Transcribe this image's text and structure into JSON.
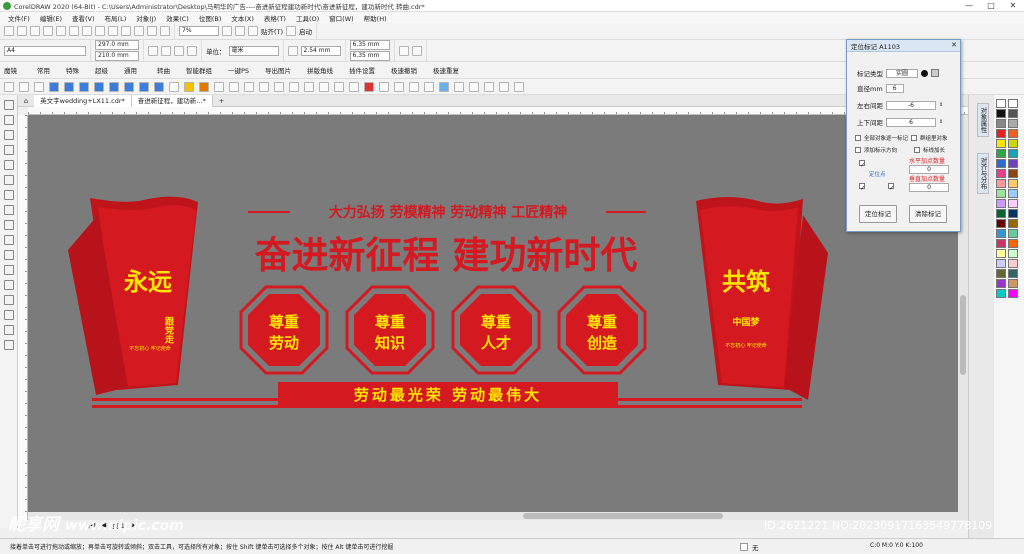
{
  "window": {
    "title": "CorelDRAW 2020 (64-Bit) - C:\\Users\\Administrator\\Desktop\\马明华的广告----奋进新征程建功新时代\\奋进新征程，建功新时代 转曲.cdr*",
    "min": "—",
    "max": "□",
    "close": "✕"
  },
  "menu": [
    "文件(F)",
    "编辑(E)",
    "查看(V)",
    "布局(L)",
    "对象(J)",
    "效果(C)",
    "位图(B)",
    "文本(X)",
    "表格(T)",
    "工具(O)",
    "窗口(W)",
    "帮助(H)"
  ],
  "toolbar": {
    "zoom": "7%",
    "snap_label": "贴齐(T)",
    "launch_label": "启动"
  },
  "property_bar": {
    "page_size": "A4",
    "width": "297.0 mm",
    "height": "210.0 mm",
    "units_label": "单位：",
    "units": "毫米",
    "nudge": "2.54 mm",
    "dup_x": "6.35 mm",
    "dup_y": "6.35 mm"
  },
  "plugin_bar": [
    "魔镜",
    "常用",
    "特殊",
    "超级",
    "通用",
    "转曲",
    "智能群组",
    "一键PS",
    "导出图片",
    "拼版角线",
    "插件设置",
    "极速撤销",
    "极速重复"
  ],
  "doc_tabs": {
    "home": "欢迎屏幕",
    "tab1": "英文字wedding+LX11.cdr*",
    "tab2": "奋进新征程，建功新...*"
  },
  "page_nav": {
    "page": "页 1"
  },
  "design": {
    "top_slogan": "大力弘扬 劳模精神 劳动精神 工匠精神",
    "main_title": "奋进新征程 建功新时代",
    "octagons": [
      {
        "line1": "尊重",
        "line2": "劳动"
      },
      {
        "line1": "尊重",
        "line2": "知识"
      },
      {
        "line1": "尊重",
        "line2": "人才"
      },
      {
        "line1": "尊重",
        "line2": "创造"
      }
    ],
    "banner": "劳动最光荣  劳动最伟大",
    "left_book": {
      "big": "永远",
      "vertical": "跟党走",
      "small": "不忘初心 牢记使命"
    },
    "right_book": {
      "big": "共筑",
      "vertical": "中国梦",
      "small": "不忘初心 牢记使命"
    },
    "colors": {
      "red": "#d41921",
      "yellow": "#ffe600",
      "canvas": "#7b7b7b"
    }
  },
  "dialog": {
    "title": "定位标记 A1103",
    "type_label": "标记类型",
    "type_value": "实圆",
    "diameter_label": "直径mm",
    "diameter_value": "6",
    "lr_label": "左右间距",
    "lr_value": "-6",
    "tb_label": "上下间距",
    "tb_value": "6",
    "opt1": "全部对象逐一标记",
    "opt2": "群组里对象",
    "opt3": "添加标示方向",
    "opt4": "标线加长",
    "opt5": "定位点",
    "h_count_label": "水平加点数量",
    "h_count": "0",
    "v_count_label": "垂直加点数量",
    "v_count": "0",
    "btn_mark": "定位标记",
    "btn_clear": "清除标记"
  },
  "dock_tabs": [
    "对象属性",
    "对齐与分布"
  ],
  "status": {
    "hint": "接着单击可进行拖动或缩放；再单击可旋转或倾斜；双击工具，可选择所有对象；按住 Shift 键单击可选择多个对象；按住 Alt 键单击可进行挖掘",
    "fill": "无",
    "color_readout": "C:0 M:0 Y:0 K:100"
  },
  "watermark": {
    "site": "昵享网",
    "url": "www.nipic.com",
    "id": "ID:2621221 NO:20230917163549778109"
  }
}
